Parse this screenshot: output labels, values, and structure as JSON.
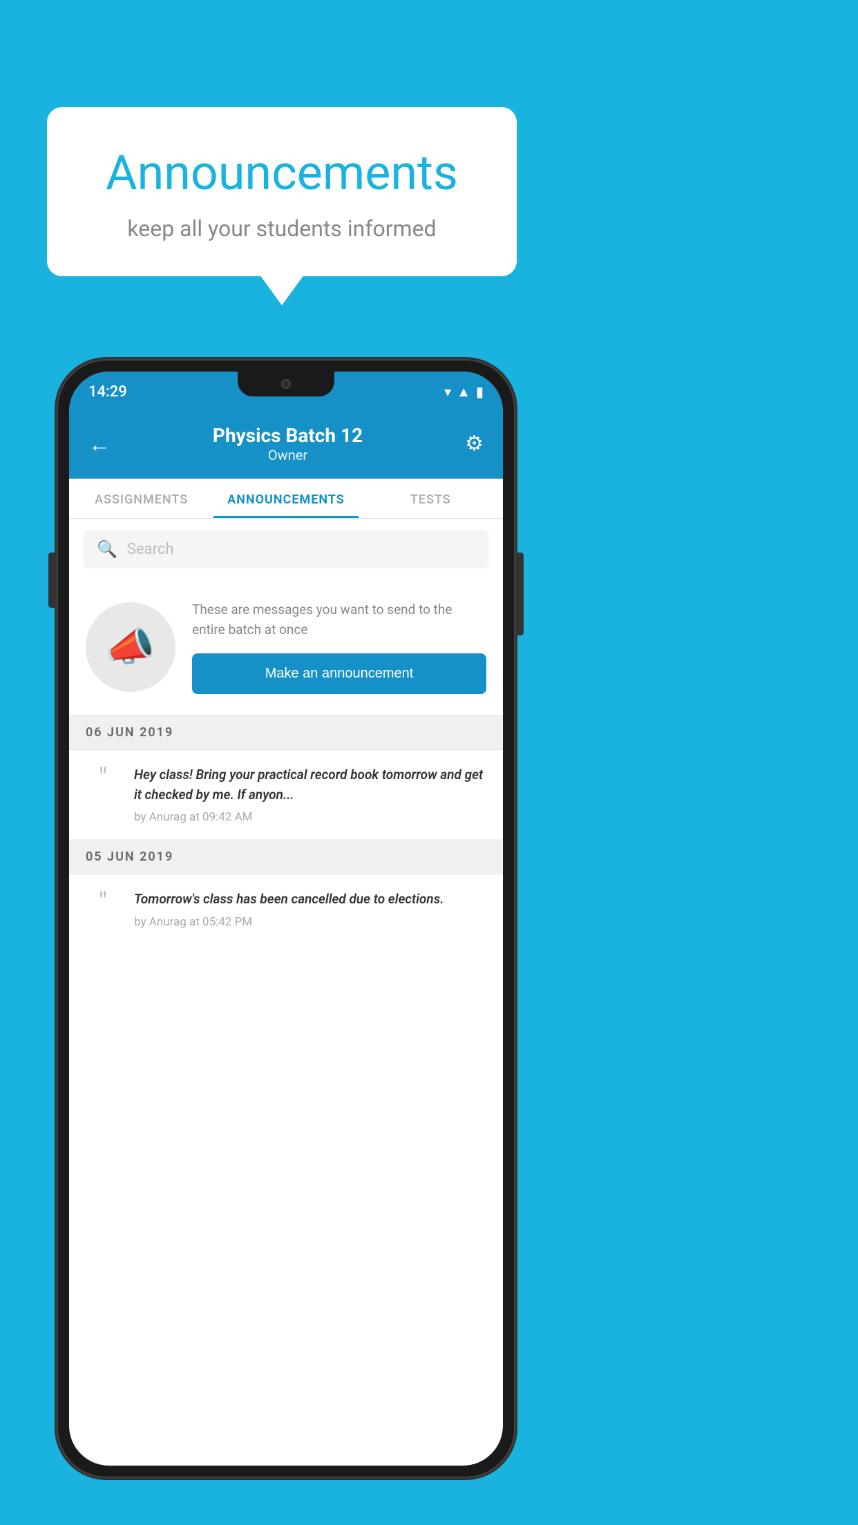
{
  "bubble": {
    "title": "Announcements",
    "subtitle": "keep all your students informed"
  },
  "phone": {
    "statusBar": {
      "time": "14:29"
    },
    "header": {
      "title": "Physics Batch 12",
      "subtitle": "Owner",
      "backLabel": "←",
      "gearLabel": "⚙"
    },
    "tabs": [
      {
        "label": "ASSIGNMENTS",
        "active": false
      },
      {
        "label": "ANNOUNCEMENTS",
        "active": true
      },
      {
        "label": "TESTS",
        "active": false
      }
    ],
    "search": {
      "placeholder": "Search"
    },
    "announcementPrompt": {
      "promptText": "These are messages you want to send to the entire batch at once",
      "buttonLabel": "Make an announcement"
    },
    "dateSections": [
      {
        "date": "06  JUN  2019",
        "items": [
          {
            "message": "Hey class! Bring your practical record book tomorrow and get it checked by me. If anyon...",
            "meta": "by Anurag at 09:42 AM"
          }
        ]
      },
      {
        "date": "05  JUN  2019",
        "items": [
          {
            "message": "Tomorrow's class has been cancelled due to elections.",
            "meta": "by Anurag at 05:42 PM"
          }
        ]
      }
    ]
  }
}
